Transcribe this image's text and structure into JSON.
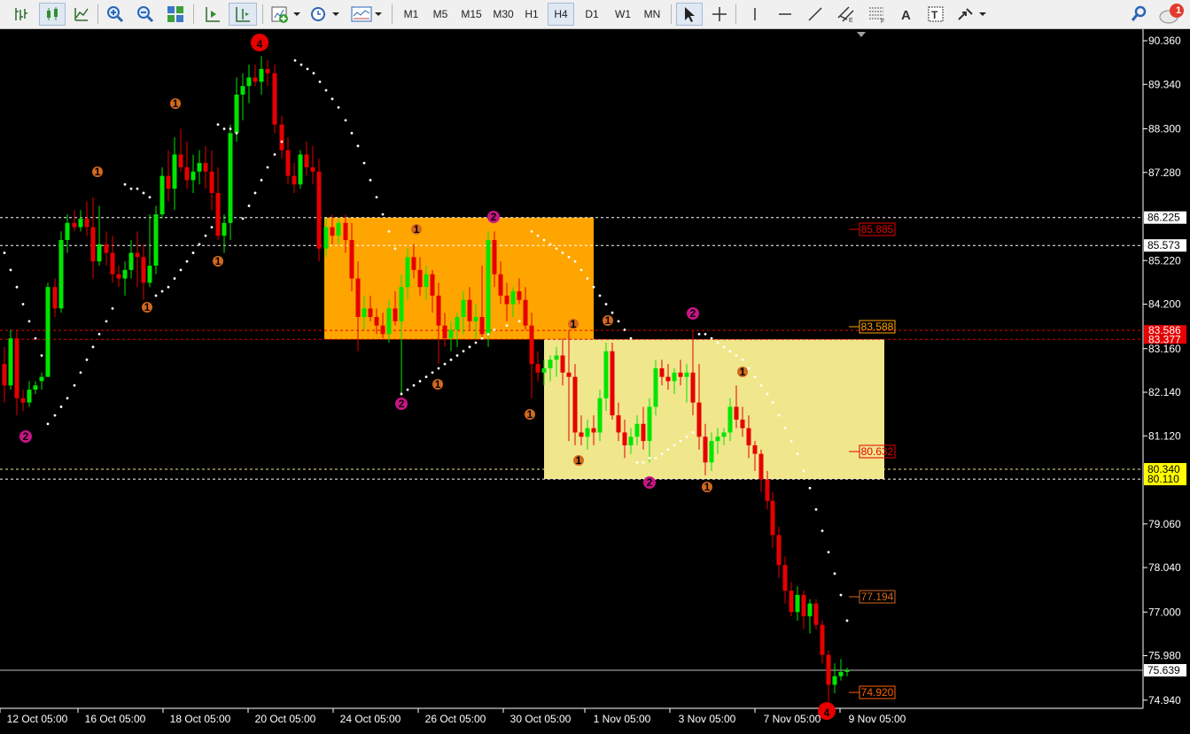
{
  "toolbar": {
    "timeframes": [
      "M1",
      "M5",
      "M15",
      "M30",
      "H1",
      "H4",
      "D1",
      "W1",
      "MN"
    ],
    "active_timeframe": "H4",
    "notification_count": "1"
  },
  "chart": {
    "price_ticks": [
      "90.360",
      "89.340",
      "88.300",
      "87.280",
      "86.225",
      "85.573",
      "85.220",
      "84.200",
      "83.160",
      "82.140",
      "81.120",
      "80.340",
      "80.110",
      "79.060",
      "78.040",
      "77.000",
      "75.980",
      "75.639",
      "74.940"
    ],
    "date_labels": [
      "12 Oct 05:00",
      "16 Oct 05:00",
      "18 Oct 05:00",
      "20 Oct 05:00",
      "24 Oct 05:00",
      "26 Oct 05:00",
      "30 Oct 05:00",
      "1 Nov 05:00",
      "3 Nov 05:00",
      "7 Nov 05:00",
      "9 Nov 05:00"
    ],
    "box_labels": [
      "85.885",
      "83.588",
      "80.632",
      "77.194",
      "74.920"
    ],
    "hline_labels": {
      "upper_white": "86.225",
      "upper_white2": "85.573",
      "red1": "83.586",
      "red2": "83.377",
      "yellow1": "80.340",
      "yellow2": "80.110",
      "current": "75.639"
    },
    "wave_labels": [
      "4",
      "1",
      "1",
      "1",
      "1",
      "1",
      "1",
      "1",
      "1",
      "1",
      "1",
      "1",
      "2",
      "2",
      "2",
      "2",
      "2",
      "4"
    ],
    "colors": {
      "bull": "#00e600",
      "bear": "#e60000",
      "orange_zone": "#ffa500",
      "yellow_zone": "#f0e68c",
      "sar": "#ffffff"
    }
  }
}
